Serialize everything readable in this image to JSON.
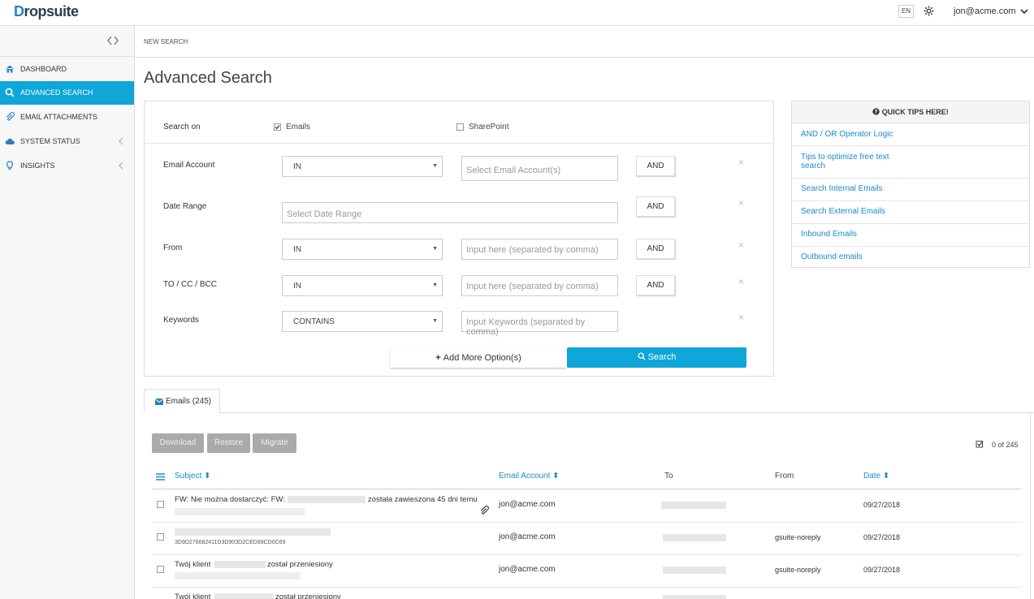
{
  "header": {
    "logo_initial": "D",
    "logo_rest": "ropsuite",
    "language": "EN",
    "user_email": "jon@acme.com"
  },
  "sidebar": {
    "items": [
      {
        "label": "DASHBOARD",
        "icon": "home-icon",
        "active": false
      },
      {
        "label": "ADVANCED SEARCH",
        "icon": "search-icon",
        "active": true
      },
      {
        "label": "EMAIL ATTACHMENTS",
        "icon": "paperclip-icon",
        "active": false
      },
      {
        "label": "SYSTEM STATUS",
        "icon": "cloud-icon",
        "active": false
      },
      {
        "label": "INSIGHTS",
        "icon": "lightbulb-icon",
        "active": false
      }
    ]
  },
  "breadcrumb": "NEW SEARCH",
  "page_title": "Advanced Search",
  "search_form": {
    "search_on_label": "Search on",
    "emails_label": "Emails",
    "emails_checked": true,
    "sharepoint_label": "SharePoint",
    "sharepoint_checked": false,
    "rows": [
      {
        "label": "Email Account",
        "operator": "IN",
        "placeholder": "Select Email Account(s)",
        "conjunction": "AND"
      },
      {
        "label": "Date Range",
        "placeholder": "Select Date Range",
        "conjunction": "AND"
      },
      {
        "label": "From",
        "operator": "IN",
        "placeholder": "Input here (separated by comma)",
        "conjunction": "AND"
      },
      {
        "label": "TO / CC / BCC",
        "operator": "IN",
        "placeholder": "Input here (separated by comma)",
        "conjunction": "AND"
      },
      {
        "label": "Keywords",
        "operator": "CONTAINS",
        "placeholder": "Input Keywords (separated by comma)"
      }
    ],
    "remove_glyph": "×",
    "add_more_label": "Add More Option(s)",
    "search_label": "Search"
  },
  "quick_tips": {
    "title": "QUICK TIPS HERE!",
    "items": [
      "AND / OR Operator Logic",
      "Tips to optimize free text search",
      "Search Internal Emails",
      "Search External Emails",
      "Inbound Emails",
      "Outbound emails"
    ]
  },
  "results": {
    "tab_label": "Emails (245)",
    "actions": [
      "Download",
      "Restore",
      "Migrate"
    ],
    "selection_count": "0 of 245",
    "columns": [
      "Subject",
      "Email Account",
      "To",
      "From",
      "Date"
    ],
    "rows": [
      {
        "subject_a": "FW: Nie można dostarczyć: FW:",
        "subject_b": "została zawieszona 45 dni temu",
        "account": "jon@acme.com",
        "from": "",
        "date": "09/27/2018",
        "attachment": true
      },
      {
        "subject_a": "",
        "subject_b": "3D9D276682411D3D903D2CED89CD0C69",
        "account": "jon@acme.com",
        "from": "gsuite-noreply",
        "date": "09/27/2018",
        "attachment": false
      },
      {
        "subject_a": "Twój klient",
        "subject_b": "został przeniesiony",
        "account": "jon@acme.com",
        "from": "gsuite-noreply",
        "date": "09/27/2018",
        "attachment": false
      },
      {
        "subject_a": "Twój klient",
        "subject_b": "został przeniesiony",
        "account": "",
        "from": "",
        "date": "",
        "attachment": false
      }
    ]
  },
  "colors": {
    "accent": "#0fa6d8",
    "link": "#1a8cc8",
    "disabled_button": "#aaaaaa"
  }
}
